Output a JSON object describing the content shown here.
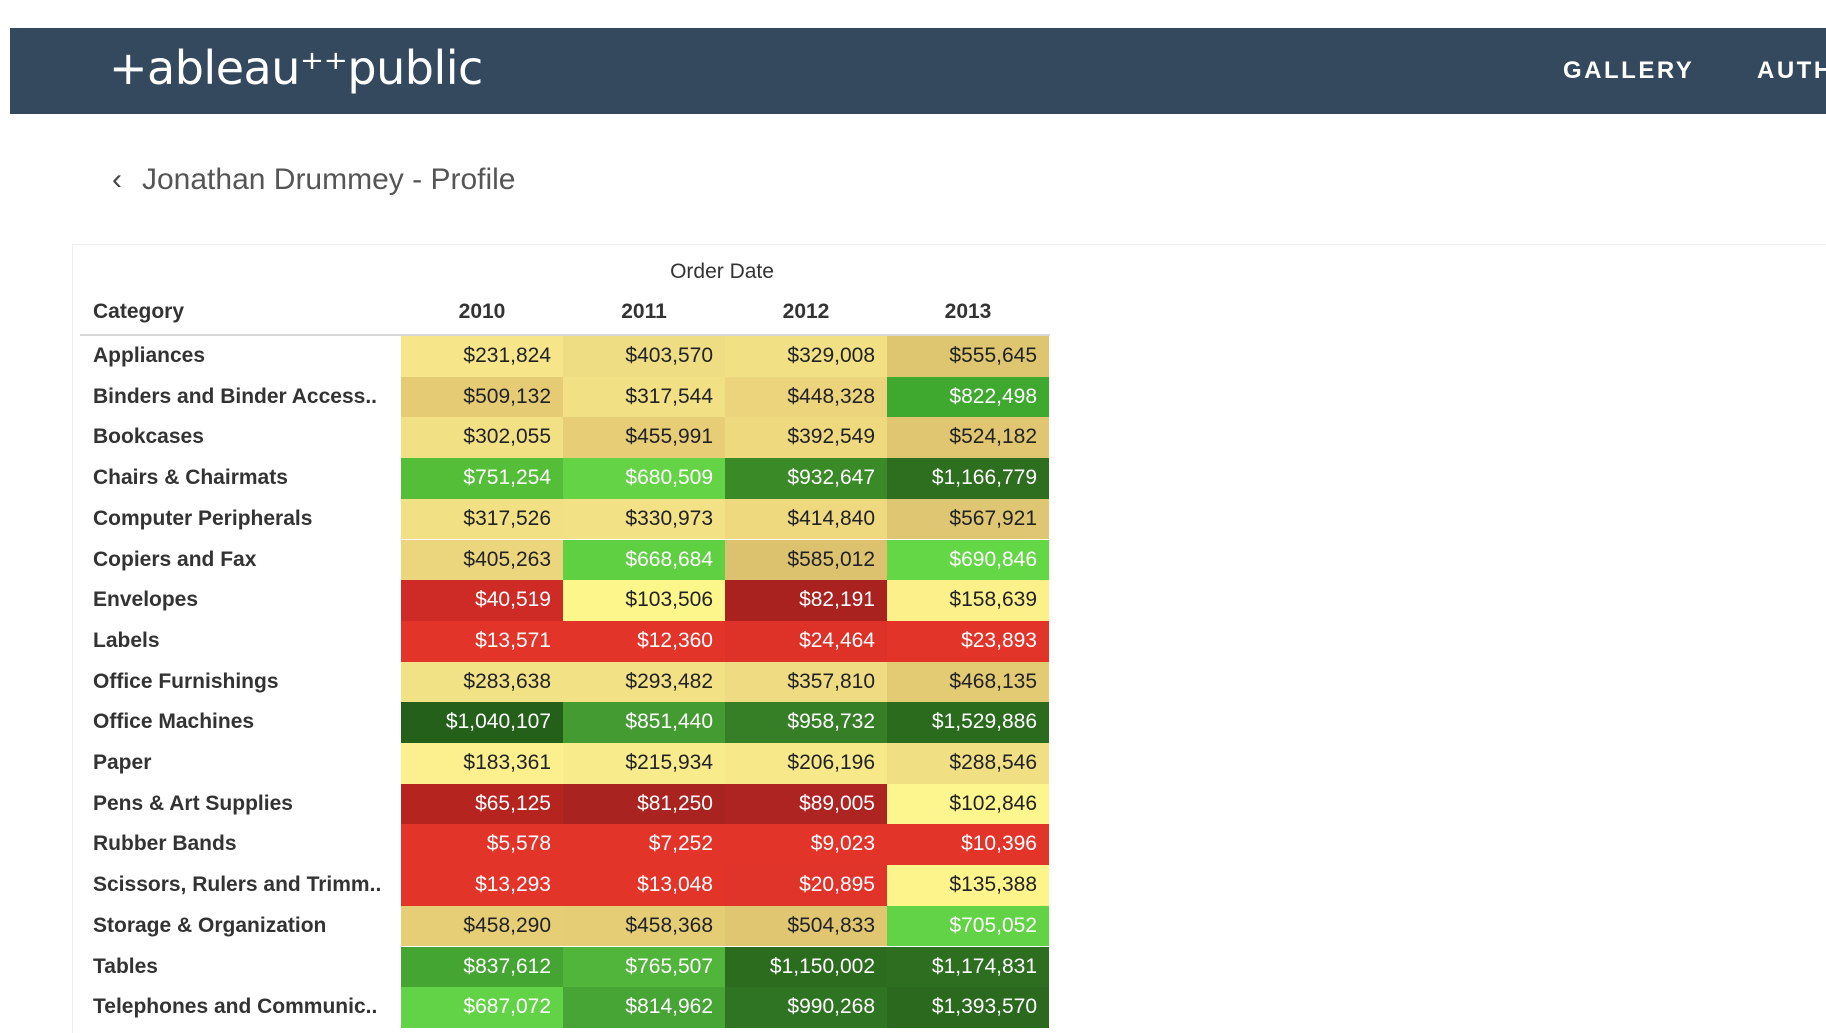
{
  "header": {
    "logo_text": "+ableau⁺⁺public",
    "nav": [
      "GALLERY",
      "AUTH"
    ]
  },
  "breadcrumb": {
    "chevron": "‹",
    "label": "Jonathan Drummey - Profile"
  },
  "chart_data": {
    "type": "heatmap",
    "column_group_label": "Order Date",
    "row_header": "Category",
    "columns": [
      "2010",
      "2011",
      "2012",
      "2013"
    ],
    "rows": [
      {
        "category": "Appliances",
        "values": [
          "$231,824",
          "$403,570",
          "$329,008",
          "$555,645"
        ],
        "colors": [
          "#f6e689",
          "#efdd83",
          "#f2e184",
          "#ddc66f"
        ]
      },
      {
        "category": "Binders and Binder Access..",
        "values": [
          "$509,132",
          "$317,544",
          "$448,328",
          "$822,498"
        ],
        "colors": [
          "#e4cb74",
          "#f1e084",
          "#ebd47c",
          "#3fa82f"
        ]
      },
      {
        "category": "Bookcases",
        "values": [
          "$302,055",
          "$455,991",
          "$392,549",
          "$524,182"
        ],
        "colors": [
          "#f1e084",
          "#e6cd76",
          "#eed97f",
          "#e0c671"
        ]
      },
      {
        "category": "Chairs & Chairmats",
        "values": [
          "$751,254",
          "$680,509",
          "$932,647",
          "$1,166,779"
        ],
        "colors": [
          "#55be39",
          "#64d446",
          "#3a8b28",
          "#2d6e1f"
        ]
      },
      {
        "category": "Computer Peripherals",
        "values": [
          "$317,526",
          "$330,973",
          "$414,840",
          "$567,921"
        ],
        "colors": [
          "#f1e084",
          "#f2e185",
          "#eed97f",
          "#dfc672"
        ]
      },
      {
        "category": "Copiers and Fax",
        "values": [
          "$405,263",
          "$668,684",
          "$585,012",
          "$690,846"
        ],
        "colors": [
          "#ecd67d",
          "#5ed042",
          "#dcc26e",
          "#64d747"
        ]
      },
      {
        "category": "Envelopes",
        "values": [
          "$40,519",
          "$103,506",
          "$82,191",
          "$158,639"
        ],
        "colors": [
          "#ce2b26",
          "#fdf68b",
          "#a92220",
          "#fcf08b"
        ]
      },
      {
        "category": "Labels",
        "values": [
          "$13,571",
          "$12,360",
          "$24,464",
          "$23,893"
        ],
        "colors": [
          "#e3342a",
          "#e3342a",
          "#de3128",
          "#e3342a"
        ]
      },
      {
        "category": "Office Furnishings",
        "values": [
          "$283,638",
          "$293,482",
          "$357,810",
          "$468,135"
        ],
        "colors": [
          "#f2e286",
          "#f2e185",
          "#efdb81",
          "#e3cb74"
        ]
      },
      {
        "category": "Office Machines",
        "values": [
          "$1,040,107",
          "$851,440",
          "$958,732",
          "$1,529,886"
        ],
        "colors": [
          "#25601b",
          "#449b31",
          "#367f26",
          "#2b6b1e"
        ]
      },
      {
        "category": "Paper",
        "values": [
          "$183,361",
          "$215,934",
          "$206,196",
          "$288,546"
        ],
        "colors": [
          "#fbf08d",
          "#f8eb8b",
          "#f7e98a",
          "#f1df84"
        ]
      },
      {
        "category": "Pens & Art Supplies",
        "values": [
          "$65,125",
          "$81,250",
          "$89,005",
          "$102,846"
        ],
        "colors": [
          "#b5241f",
          "#a92321",
          "#ad2422",
          "#fdf68e"
        ]
      },
      {
        "category": "Rubber Bands",
        "values": [
          "$5,578",
          "$7,252",
          "$9,023",
          "$10,396"
        ],
        "colors": [
          "#e3342a",
          "#e3342a",
          "#e3342a",
          "#e3342a"
        ]
      },
      {
        "category": "Scissors, Rulers and Trimm..",
        "values": [
          "$13,293",
          "$13,048",
          "$20,895",
          "$135,388"
        ],
        "colors": [
          "#e3342a",
          "#e3342a",
          "#e0332a",
          "#fdf58c"
        ]
      },
      {
        "category": "Storage & Organization",
        "values": [
          "$458,290",
          "$458,368",
          "$504,833",
          "$705,052"
        ],
        "colors": [
          "#e6ce77",
          "#e5cd76",
          "#e0c671",
          "#62d246"
        ]
      },
      {
        "category": "Tables",
        "values": [
          "$837,612",
          "$765,507",
          "$1,150,002",
          "$1,174,831"
        ],
        "colors": [
          "#45a533",
          "#50b53a",
          "#2c6c1f",
          "#2d6e20"
        ]
      },
      {
        "category": "Telephones and Communic..",
        "values": [
          "$687,072",
          "$814,962",
          "$990,268",
          "$1,393,570"
        ],
        "colors": [
          "#62d346",
          "#46a534",
          "#2f7422",
          "#2b6a1e"
        ]
      }
    ]
  }
}
